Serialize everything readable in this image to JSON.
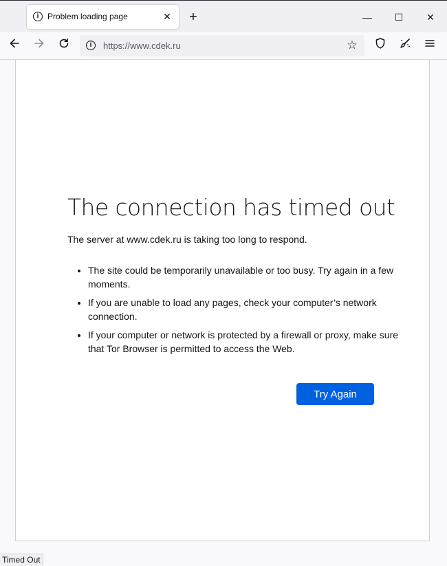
{
  "tab": {
    "title": "Problem loading page",
    "info_icon": "info-icon",
    "close_icon": "close-icon"
  },
  "window": {
    "new_tab_icon": "plus-icon",
    "minimize_icon": "minimize-icon",
    "maximize_icon": "maximize-icon",
    "close_icon": "close-icon"
  },
  "nav": {
    "back_icon": "arrow-left-icon",
    "forward_icon": "arrow-right-icon",
    "reload_icon": "reload-icon",
    "url": "https://www.cdek.ru",
    "bookmark_icon": "star-icon",
    "shield_icon": "shield-icon",
    "extensions_icon": "broom-icon",
    "menu_icon": "hamburger-icon"
  },
  "error": {
    "title": "The connection has timed out",
    "description": "The server at www.cdek.ru is taking too long to respond.",
    "bullets": [
      "The site could be temporarily unavailable or too busy. Try again in a few moments.",
      "If you are unable to load any pages, check your computer’s network connection.",
      "If your computer or network is protected by a firewall or proxy, make sure that Tor Browser is permitted to access the Web."
    ],
    "try_again": "Try Again"
  },
  "status": "Timed Out",
  "colors": {
    "button": "#0061e0",
    "tabbar": "#f0f0f4",
    "page_bg": "#ffffff"
  }
}
